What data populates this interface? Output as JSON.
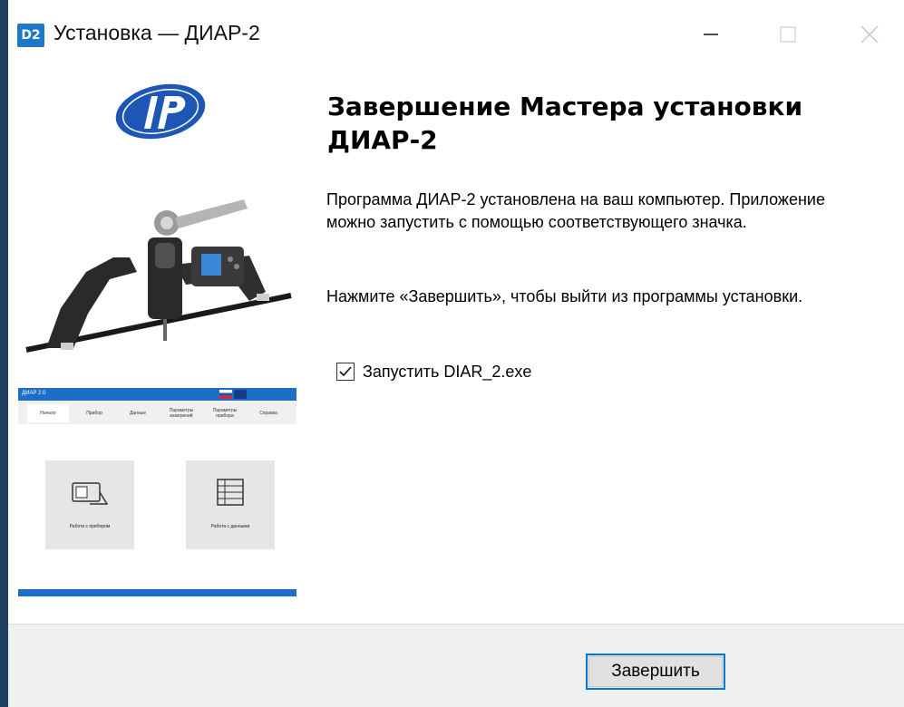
{
  "window": {
    "icon_text": "D2",
    "title": "Установка — ДИАР-2"
  },
  "content": {
    "heading": "Завершение Мастера установки ДИАР-2",
    "paragraph1": "Программа ДИАР-2 установлена на ваш компьютер. Приложение можно запустить с помощью соответствующего значка.",
    "paragraph2": "Нажмите «Завершить», чтобы выйти из программы установки.",
    "launch_checkbox": {
      "label": "Запустить DIAR_2.exe",
      "checked": true
    }
  },
  "preview": {
    "title": "ДИАР 2.0",
    "tabs": [
      "Начало",
      "Прибор",
      "Данные",
      "Параметры измерений",
      "Параметры прибора",
      "Справка"
    ],
    "cards": [
      "Работа с прибором",
      "Работа с данными"
    ]
  },
  "footer": {
    "finish_label": "Завершить"
  },
  "colors": {
    "accent": "#0078d7",
    "brand_blue": "#1d6fc5"
  }
}
